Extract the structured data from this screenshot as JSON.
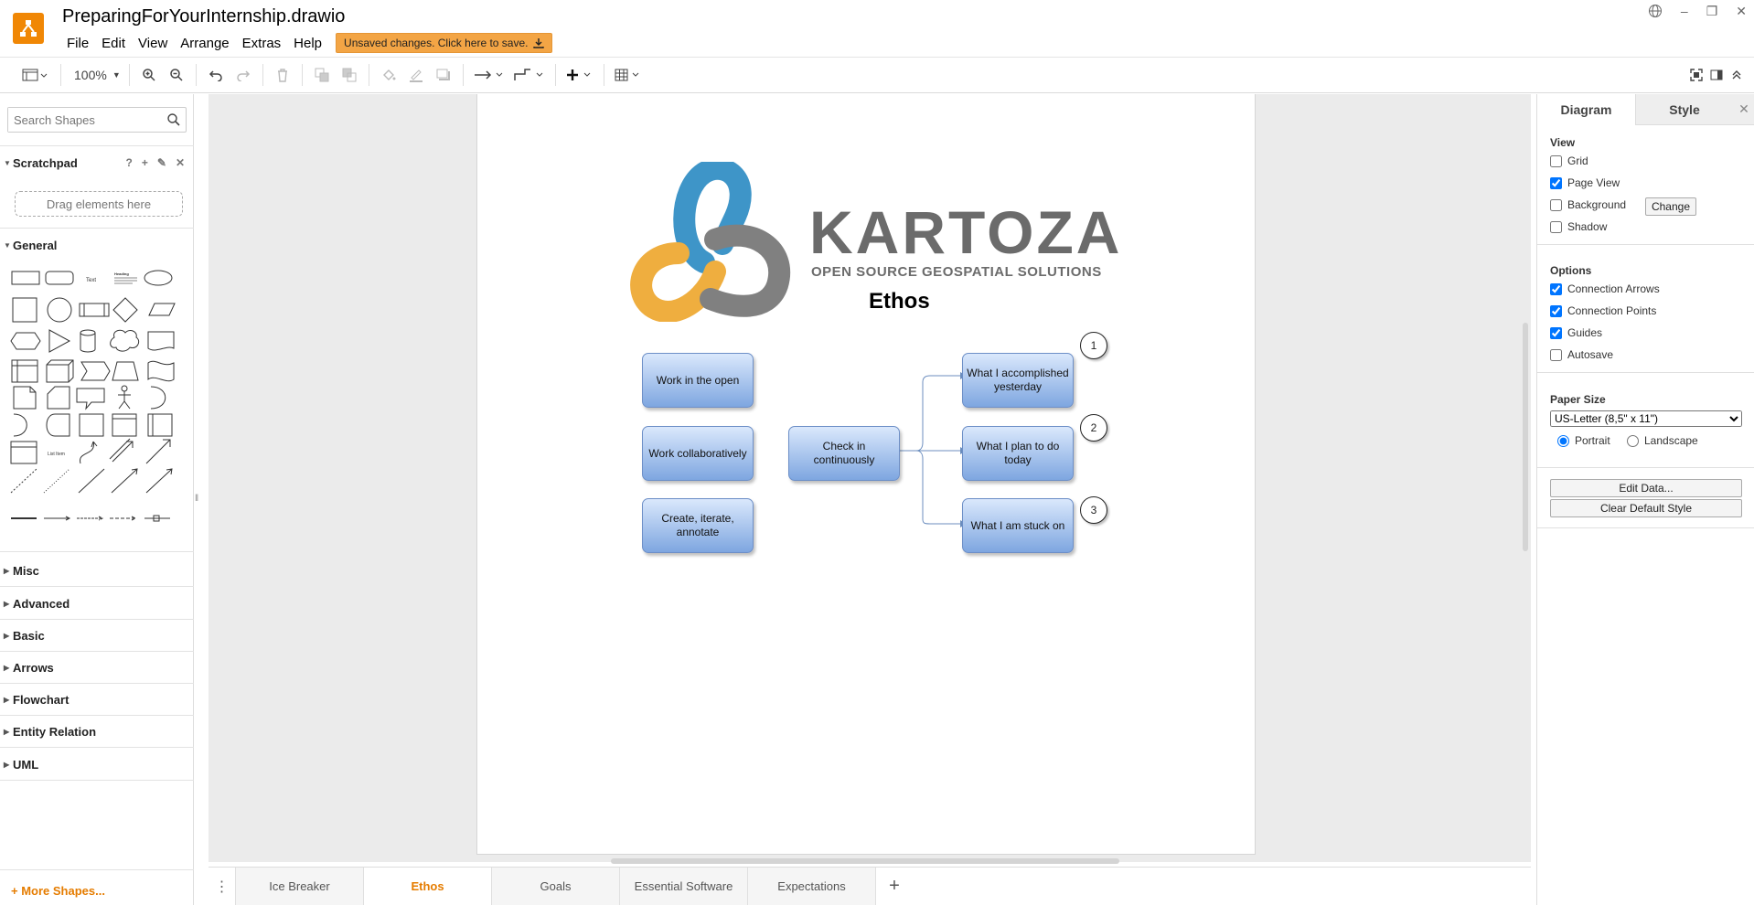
{
  "title": "PreparingForYourInternship.drawio",
  "menu": [
    "File",
    "Edit",
    "View",
    "Arrange",
    "Extras",
    "Help"
  ],
  "save_banner": "Unsaved changes. Click here to save.",
  "toolbar": {
    "zoom": "100%"
  },
  "sidebar": {
    "search_placeholder": "Search Shapes",
    "scratchpad": "Scratchpad",
    "scratch_tools": [
      "?",
      "+",
      "✎",
      "✕"
    ],
    "drop_zone": "Drag elements here",
    "general": "General",
    "sections": [
      "Misc",
      "Advanced",
      "Basic",
      "Arrows",
      "Flowchart",
      "Entity Relation",
      "UML"
    ],
    "more_shapes": "+ More Shapes...",
    "shape_texts": {
      "text": "Text",
      "heading": "Heading",
      "list": "List Item"
    }
  },
  "diagram": {
    "brand": "KARTOZA",
    "tagline": "OPEN SOURCE GEOSPATIAL SOLUTIONS",
    "heading": "Ethos",
    "nodes": {
      "open": "Work in the open",
      "collab": "Work collaboratively",
      "create": "Create, iterate, annotate",
      "checkin": "Check in continuously",
      "yesterday": "What I accomplished yesterday",
      "today": "What I plan to do today",
      "stuck": "What I am stuck on"
    },
    "markers": [
      "1",
      "2",
      "3"
    ],
    "colors": {
      "node_top": "#dae8fc",
      "node_bottom": "#7ea6e0",
      "edge": "#6c8ebf",
      "logo_blue": "#3e95c8",
      "logo_orange": "#efae3f",
      "logo_gray": "#808080"
    }
  },
  "tabs": {
    "items": [
      "Ice Breaker",
      "Ethos",
      "Goals",
      "Essential Software",
      "Expectations"
    ],
    "active": "Ethos",
    "add": "+"
  },
  "format_panel": {
    "tabs": [
      "Diagram",
      "Style"
    ],
    "view_heading": "View",
    "grid": "Grid",
    "page_view": "Page View",
    "background": "Background",
    "change": "Change",
    "shadow": "Shadow",
    "options_heading": "Options",
    "connection_arrows": "Connection Arrows",
    "connection_points": "Connection Points",
    "guides": "Guides",
    "autosave": "Autosave",
    "paper_heading": "Paper Size",
    "paper_value": "US-Letter (8,5\" x 11\")",
    "portrait": "Portrait",
    "landscape": "Landscape",
    "edit_data": "Edit Data...",
    "clear_style": "Clear Default Style"
  }
}
